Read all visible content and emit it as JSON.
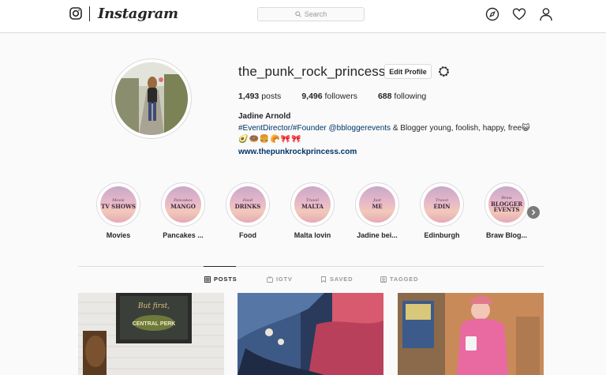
{
  "app": {
    "name": "Instagram"
  },
  "nav": {
    "search_placeholder": "Search"
  },
  "profile": {
    "username": "the_punk_rock_princess",
    "edit_button": "Edit Profile",
    "stats": [
      {
        "count": "1,493",
        "label": "posts"
      },
      {
        "count": "9,496",
        "label": "followers"
      },
      {
        "count": "688",
        "label": "following"
      }
    ],
    "full_name": "Jadine Arnold",
    "bio_links": "#EventDirector/#Founder @bbloggerevents",
    "bio_text": " & Blogger young, foolish, happy, free😺",
    "bio_emojis": "🥑🍩🍔🥐🎀🎀",
    "website": "www.thepunkrockprincess.com"
  },
  "highlights": [
    {
      "label": "Movies",
      "cover_small": "Movie",
      "cover_big": "TV Shows"
    },
    {
      "label": "Pancakes ...",
      "cover_small": "Pancakes",
      "cover_big": "Mango"
    },
    {
      "label": "Food",
      "cover_small": "Food",
      "cover_big": "Drinks"
    },
    {
      "label": "Malta lovin",
      "cover_small": "Travel",
      "cover_big": "Malta"
    },
    {
      "label": "Jadine bei...",
      "cover_small": "Just",
      "cover_big": "Me"
    },
    {
      "label": "Edinburgh",
      "cover_small": "Travel",
      "cover_big": "Edin"
    },
    {
      "label": "Braw Blog...",
      "cover_small": "Braw",
      "cover_big": "Blogger Events"
    }
  ],
  "tabs": [
    {
      "label": "POSTS",
      "icon": "grid-icon",
      "active": true
    },
    {
      "label": "IGTV",
      "icon": "igtv-icon",
      "active": false
    },
    {
      "label": "SAVED",
      "icon": "bookmark-icon",
      "active": false
    },
    {
      "label": "TAGGED",
      "icon": "tagged-icon",
      "active": false
    }
  ],
  "posts": [
    {
      "sign_text": "But first,",
      "sign_text2": "CENTRAL PERK"
    },
    {
      "description": ""
    },
    {
      "description": ""
    }
  ],
  "colors": {
    "link": "#003569",
    "border": "#dbdbdb",
    "background": "#fafafa",
    "text": "#262626",
    "muted": "#999999"
  }
}
